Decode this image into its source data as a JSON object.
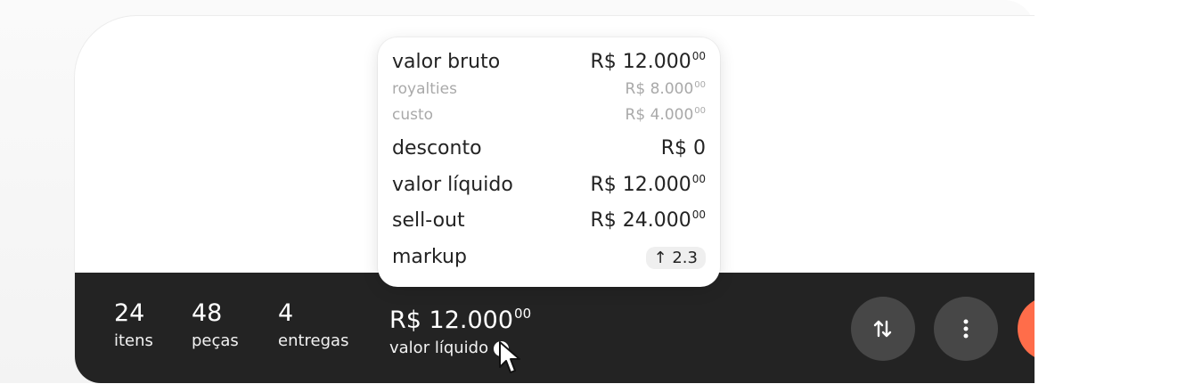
{
  "summary": {
    "items": {
      "value": "24",
      "label": "itens"
    },
    "pieces": {
      "value": "48",
      "label": "peças"
    },
    "deliveries": {
      "value": "4",
      "label": "entregas"
    },
    "net_value": {
      "currency": "R$",
      "integer": "12.000",
      "cents": "00",
      "label": "valor líquido"
    }
  },
  "tooltip": {
    "gross_value": {
      "label": "valor bruto",
      "currency": "R$",
      "integer": "12.000",
      "cents": "00"
    },
    "royalties": {
      "label": "royalties",
      "currency": "R$",
      "integer": "8.000",
      "cents": "00"
    },
    "cost": {
      "label": "custo",
      "currency": "R$",
      "integer": "4.000",
      "cents": "00"
    },
    "discount": {
      "label": "desconto",
      "value": "R$ 0"
    },
    "net_value": {
      "label": "valor líquido",
      "currency": "R$",
      "integer": "12.000",
      "cents": "00"
    },
    "sell_out": {
      "label": "sell-out",
      "currency": "R$",
      "integer": "24.000",
      "cents": "00"
    },
    "markup": {
      "label": "markup",
      "arrow": "↑",
      "value": "2.3"
    }
  },
  "actions": {
    "sort_icon": "sort-arrows-icon",
    "more_icon": "more-vertical-icon"
  },
  "colors": {
    "bar_background": "#232323",
    "button_background": "#474747",
    "accent": "#ff6d4a"
  }
}
